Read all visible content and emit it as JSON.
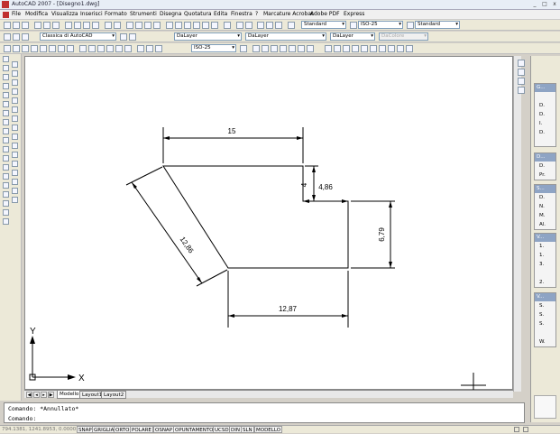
{
  "window": {
    "title": "AutoCAD 2007 - [Disegno1.dwg]",
    "minimize": "_",
    "maximize": "□",
    "close": "x"
  },
  "menu": [
    "File",
    "Modifica",
    "Visualizza",
    "Inserisci",
    "Formato",
    "Strumenti",
    "Disegna",
    "Quotatura",
    "Edita",
    "Finestra",
    "?",
    "Marcature Acrobat",
    "Adobe PDF",
    "Express"
  ],
  "toolbars": {
    "text_style": "Standard",
    "dim_style": "ISO-25",
    "table_style": "Standard",
    "workspace": "Classica di AutoCAD",
    "layer": "DaLayer",
    "linetype": "DaLayer",
    "lineweight": "DaLayer",
    "plotstyle": "DaColore",
    "dim_style2": "ISO-25"
  },
  "drawing": {
    "dims": {
      "top": "15",
      "notch_height": "4",
      "notch_width": "4,86",
      "right": "6,79",
      "bottom": "12,87",
      "slant": "12,86"
    },
    "ucs_x_label": "X",
    "ucs_y_label": "Y"
  },
  "tabs": {
    "model": "Modello",
    "layout1": "Layout1",
    "layout2": "Layout2"
  },
  "command": {
    "line1": "Comando: *Annullato*",
    "line2": "Comando:"
  },
  "status": {
    "coords": "794.1381, 1241.8953, 0.0000",
    "buttons": [
      "SNAP",
      "GRIGLIA",
      "ORTO",
      "POLARE",
      "OSNAP",
      "OPUNTAMENTO",
      "UCSD",
      "DIN",
      "SLN",
      "MODELLO"
    ]
  },
  "palettes": [
    {
      "hdr": "G...",
      "items": [
        "",
        "D.",
        "D.",
        "I.",
        "D.",
        ""
      ]
    },
    {
      "hdr": "D...",
      "items": [
        "D.",
        "Pr."
      ]
    },
    {
      "hdr": "S...",
      "items": [
        "D.",
        "N.",
        "M.",
        "Al."
      ]
    },
    {
      "hdr": "V...",
      "items": [
        "1.",
        "1.",
        "3.",
        "",
        "2."
      ]
    },
    {
      "hdr": "V...",
      "items": [
        "S.",
        "S.",
        "S.",
        "",
        "W."
      ]
    }
  ]
}
